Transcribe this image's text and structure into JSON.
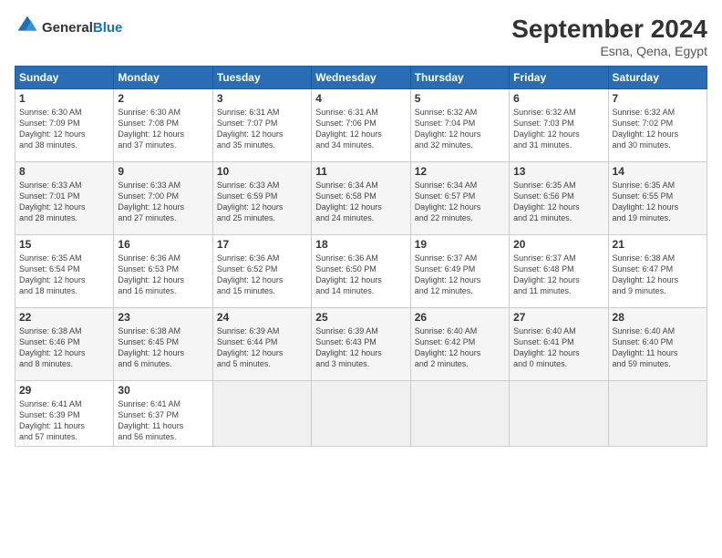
{
  "header": {
    "logo_general": "General",
    "logo_blue": "Blue",
    "month_title": "September 2024",
    "location": "Esna, Qena, Egypt"
  },
  "weekdays": [
    "Sunday",
    "Monday",
    "Tuesday",
    "Wednesday",
    "Thursday",
    "Friday",
    "Saturday"
  ],
  "weeks": [
    [
      {
        "day": "1",
        "lines": [
          "Sunrise: 6:30 AM",
          "Sunset: 7:09 PM",
          "Daylight: 12 hours",
          "and 38 minutes."
        ]
      },
      {
        "day": "2",
        "lines": [
          "Sunrise: 6:30 AM",
          "Sunset: 7:08 PM",
          "Daylight: 12 hours",
          "and 37 minutes."
        ]
      },
      {
        "day": "3",
        "lines": [
          "Sunrise: 6:31 AM",
          "Sunset: 7:07 PM",
          "Daylight: 12 hours",
          "and 35 minutes."
        ]
      },
      {
        "day": "4",
        "lines": [
          "Sunrise: 6:31 AM",
          "Sunset: 7:06 PM",
          "Daylight: 12 hours",
          "and 34 minutes."
        ]
      },
      {
        "day": "5",
        "lines": [
          "Sunrise: 6:32 AM",
          "Sunset: 7:04 PM",
          "Daylight: 12 hours",
          "and 32 minutes."
        ]
      },
      {
        "day": "6",
        "lines": [
          "Sunrise: 6:32 AM",
          "Sunset: 7:03 PM",
          "Daylight: 12 hours",
          "and 31 minutes."
        ]
      },
      {
        "day": "7",
        "lines": [
          "Sunrise: 6:32 AM",
          "Sunset: 7:02 PM",
          "Daylight: 12 hours",
          "and 30 minutes."
        ]
      }
    ],
    [
      {
        "day": "8",
        "lines": [
          "Sunrise: 6:33 AM",
          "Sunset: 7:01 PM",
          "Daylight: 12 hours",
          "and 28 minutes."
        ]
      },
      {
        "day": "9",
        "lines": [
          "Sunrise: 6:33 AM",
          "Sunset: 7:00 PM",
          "Daylight: 12 hours",
          "and 27 minutes."
        ]
      },
      {
        "day": "10",
        "lines": [
          "Sunrise: 6:33 AM",
          "Sunset: 6:59 PM",
          "Daylight: 12 hours",
          "and 25 minutes."
        ]
      },
      {
        "day": "11",
        "lines": [
          "Sunrise: 6:34 AM",
          "Sunset: 6:58 PM",
          "Daylight: 12 hours",
          "and 24 minutes."
        ]
      },
      {
        "day": "12",
        "lines": [
          "Sunrise: 6:34 AM",
          "Sunset: 6:57 PM",
          "Daylight: 12 hours",
          "and 22 minutes."
        ]
      },
      {
        "day": "13",
        "lines": [
          "Sunrise: 6:35 AM",
          "Sunset: 6:56 PM",
          "Daylight: 12 hours",
          "and 21 minutes."
        ]
      },
      {
        "day": "14",
        "lines": [
          "Sunrise: 6:35 AM",
          "Sunset: 6:55 PM",
          "Daylight: 12 hours",
          "and 19 minutes."
        ]
      }
    ],
    [
      {
        "day": "15",
        "lines": [
          "Sunrise: 6:35 AM",
          "Sunset: 6:54 PM",
          "Daylight: 12 hours",
          "and 18 minutes."
        ]
      },
      {
        "day": "16",
        "lines": [
          "Sunrise: 6:36 AM",
          "Sunset: 6:53 PM",
          "Daylight: 12 hours",
          "and 16 minutes."
        ]
      },
      {
        "day": "17",
        "lines": [
          "Sunrise: 6:36 AM",
          "Sunset: 6:52 PM",
          "Daylight: 12 hours",
          "and 15 minutes."
        ]
      },
      {
        "day": "18",
        "lines": [
          "Sunrise: 6:36 AM",
          "Sunset: 6:50 PM",
          "Daylight: 12 hours",
          "and 14 minutes."
        ]
      },
      {
        "day": "19",
        "lines": [
          "Sunrise: 6:37 AM",
          "Sunset: 6:49 PM",
          "Daylight: 12 hours",
          "and 12 minutes."
        ]
      },
      {
        "day": "20",
        "lines": [
          "Sunrise: 6:37 AM",
          "Sunset: 6:48 PM",
          "Daylight: 12 hours",
          "and 11 minutes."
        ]
      },
      {
        "day": "21",
        "lines": [
          "Sunrise: 6:38 AM",
          "Sunset: 6:47 PM",
          "Daylight: 12 hours",
          "and 9 minutes."
        ]
      }
    ],
    [
      {
        "day": "22",
        "lines": [
          "Sunrise: 6:38 AM",
          "Sunset: 6:46 PM",
          "Daylight: 12 hours",
          "and 8 minutes."
        ]
      },
      {
        "day": "23",
        "lines": [
          "Sunrise: 6:38 AM",
          "Sunset: 6:45 PM",
          "Daylight: 12 hours",
          "and 6 minutes."
        ]
      },
      {
        "day": "24",
        "lines": [
          "Sunrise: 6:39 AM",
          "Sunset: 6:44 PM",
          "Daylight: 12 hours",
          "and 5 minutes."
        ]
      },
      {
        "day": "25",
        "lines": [
          "Sunrise: 6:39 AM",
          "Sunset: 6:43 PM",
          "Daylight: 12 hours",
          "and 3 minutes."
        ]
      },
      {
        "day": "26",
        "lines": [
          "Sunrise: 6:40 AM",
          "Sunset: 6:42 PM",
          "Daylight: 12 hours",
          "and 2 minutes."
        ]
      },
      {
        "day": "27",
        "lines": [
          "Sunrise: 6:40 AM",
          "Sunset: 6:41 PM",
          "Daylight: 12 hours",
          "and 0 minutes."
        ]
      },
      {
        "day": "28",
        "lines": [
          "Sunrise: 6:40 AM",
          "Sunset: 6:40 PM",
          "Daylight: 11 hours",
          "and 59 minutes."
        ]
      }
    ],
    [
      {
        "day": "29",
        "lines": [
          "Sunrise: 6:41 AM",
          "Sunset: 6:39 PM",
          "Daylight: 11 hours",
          "and 57 minutes."
        ]
      },
      {
        "day": "30",
        "lines": [
          "Sunrise: 6:41 AM",
          "Sunset: 6:37 PM",
          "Daylight: 11 hours",
          "and 56 minutes."
        ]
      },
      {
        "day": "",
        "lines": []
      },
      {
        "day": "",
        "lines": []
      },
      {
        "day": "",
        "lines": []
      },
      {
        "day": "",
        "lines": []
      },
      {
        "day": "",
        "lines": []
      }
    ]
  ]
}
